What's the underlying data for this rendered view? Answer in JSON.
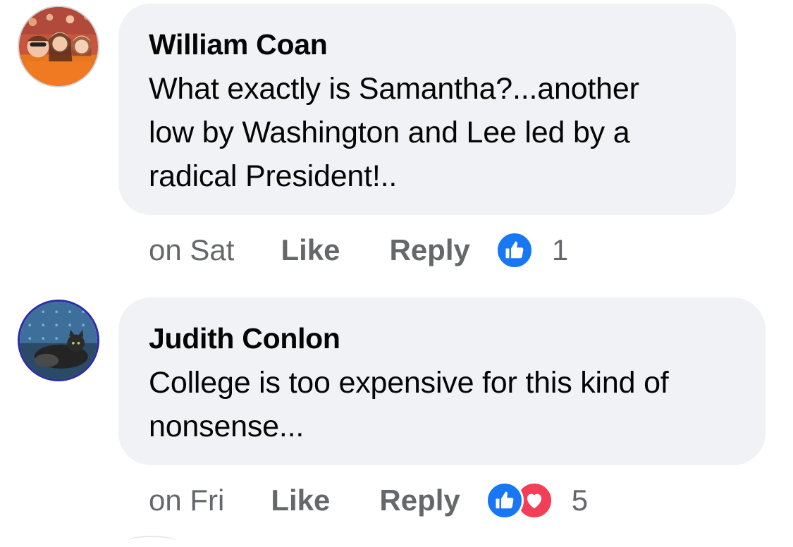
{
  "comments": [
    {
      "author": "William Coan",
      "text_lines": [
        "What exactly is Samantha?...another",
        "low by Washington and Lee led by a",
        "radical President!.."
      ],
      "time": "on Sat",
      "like_label": "Like",
      "reply_label": "Reply",
      "reactions": [
        "like-icon"
      ],
      "reaction_count": "1",
      "avatar_icon": "profile-photo-avatar"
    },
    {
      "author": "Judith Conlon",
      "text_lines": [
        "College is too expensive for this kind of",
        "nonsense..."
      ],
      "time": "on Fri",
      "like_label": "Like",
      "reply_label": "Reply",
      "reactions": [
        "like-icon",
        "love-icon"
      ],
      "reaction_count": "5",
      "avatar_icon": "cat-photo-avatar"
    }
  ],
  "colors": {
    "bubble": "#f0f2f5",
    "secondary_text": "#65676b",
    "like_blue": "#1877f2",
    "love_red": "#f33e58"
  }
}
